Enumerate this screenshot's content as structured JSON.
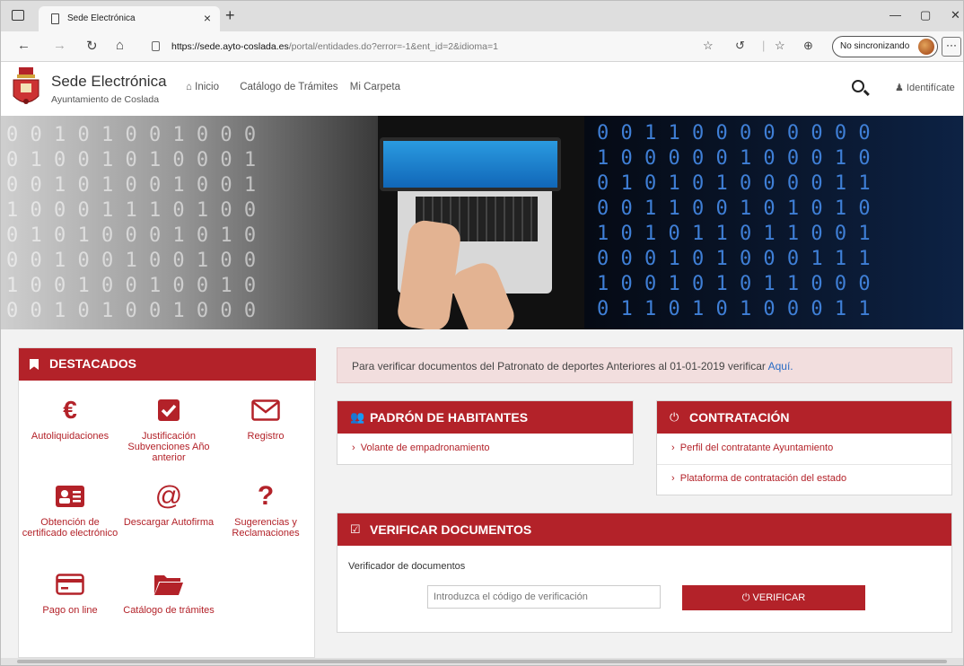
{
  "browser": {
    "tab_title": "Sede Electrónica",
    "tab_close": "×",
    "new_tab": "+",
    "url_scheme_host": "https://sede.ayto-coslada.es",
    "url_path": "/portal/entidades.do?error=-1&ent_id=2&idioma=1",
    "sync_label": "No sincronizando",
    "more_label": "···",
    "min": "—",
    "max": "▢",
    "close": "✕"
  },
  "site": {
    "title": "Sede Electrónica",
    "subtitle": "Ayuntamiento de Coslada",
    "menu": [
      "Inicio",
      "Catálogo de Trámites",
      "Mi Carpeta"
    ],
    "login": "Identifícate"
  },
  "destacados": {
    "title": "DESTACADOS",
    "items": [
      {
        "label": "Autoliquidaciones",
        "icon": "euro-icon"
      },
      {
        "label": "Justificación Subvenciones Año anterior",
        "icon": "checkbox-icon"
      },
      {
        "label": "Registro",
        "icon": "envelope-icon"
      },
      {
        "label": "Obtención de certificado electrónico",
        "icon": "id-card-icon"
      },
      {
        "label": "Descargar Autofirma",
        "icon": "at-icon"
      },
      {
        "label": "Sugerencias y Reclamaciones",
        "icon": "question-icon"
      },
      {
        "label": "Pago on line",
        "icon": "credit-card-icon"
      },
      {
        "label": "Catálogo de trámites",
        "icon": "folder-icon"
      }
    ]
  },
  "alert": {
    "text": "Para verificar documentos del Patronato de deportes Anteriores al 01-01-2019 verificar",
    "link": "Aquí."
  },
  "padron": {
    "title": "PADRÓN DE HABITANTES",
    "links": [
      "Volante de empadronamiento"
    ]
  },
  "contratacion": {
    "title": "CONTRATACIÓN",
    "links": [
      "Perfil del contratante Ayuntamiento",
      "Plataforma de contratación del estado"
    ]
  },
  "verificar": {
    "title": "VERIFICAR DOCUMENTOS",
    "label": "Verificador de documentos",
    "placeholder": "Introduzca el código de verificación",
    "button": "VERIFICAR"
  },
  "colors": {
    "brand": "#b32229",
    "alert_bg": "#f2dede"
  }
}
